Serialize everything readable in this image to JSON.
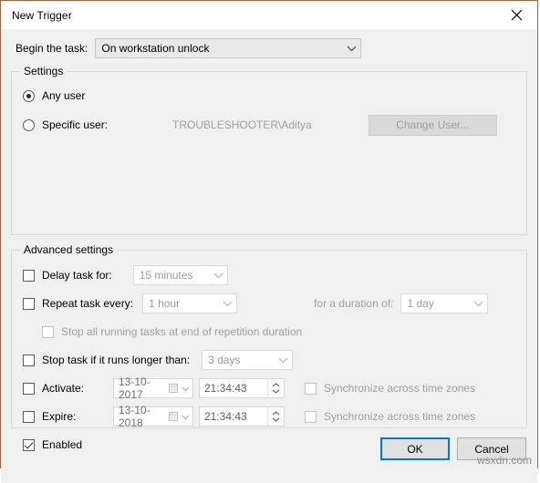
{
  "window": {
    "title": "New Trigger",
    "close_icon": "close-icon",
    "border_color": "#a4603f"
  },
  "begin": {
    "label": "Begin the task:",
    "value": "On workstation unlock"
  },
  "settings": {
    "legend": "Settings",
    "any_user_label": "Any user",
    "any_user_checked": true,
    "specific_user_label": "Specific user:",
    "specific_user_checked": false,
    "specific_user_value": "TROUBLESHOOTER\\Aditya",
    "change_user_label": "Change User...",
    "change_user_enabled": false
  },
  "advanced": {
    "legend": "Advanced settings",
    "delay": {
      "label": "Delay task for:",
      "checked": false,
      "value": "15 minutes"
    },
    "repeat": {
      "label": "Repeat task every:",
      "checked": false,
      "value": "1 hour",
      "duration_label": "for a duration of:",
      "duration_value": "1 day"
    },
    "stop_all": {
      "label": "Stop all running tasks at end of repetition duration",
      "checked": false,
      "enabled": false
    },
    "stop_longer": {
      "label": "Stop task if it runs longer than:",
      "checked": false,
      "value": "3 days"
    },
    "activate": {
      "label": "Activate:",
      "checked": false,
      "date": "13-10-2017",
      "time": "21:34:43",
      "sync_label": "Synchronize across time zones",
      "sync_checked": false
    },
    "expire": {
      "label": "Expire:",
      "checked": false,
      "date": "13-10-2018",
      "time": "21:34:43",
      "sync_label": "Synchronize across time zones",
      "sync_checked": false
    },
    "enabled": {
      "label": "Enabled",
      "checked": true
    }
  },
  "footer": {
    "ok_label": "OK",
    "cancel_label": "Cancel",
    "accent_color": "#0078d7"
  },
  "watermark": "wsxdn.com"
}
